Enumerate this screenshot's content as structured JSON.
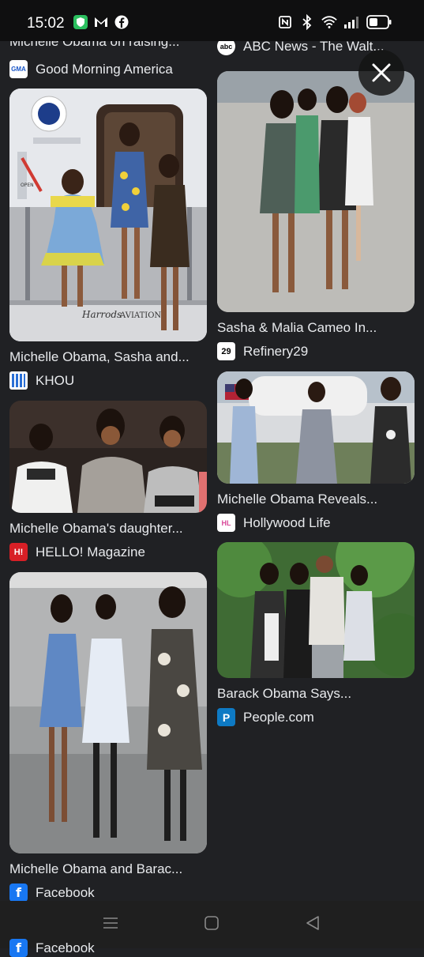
{
  "status_bar": {
    "time": "15:02",
    "left_icons": [
      "shield-icon",
      "gmail-icon",
      "facebook-icon"
    ],
    "right_icons": [
      "nfc-icon",
      "bluetooth-icon",
      "wifi-icon",
      "signal-icon",
      "battery-icon"
    ]
  },
  "close_label": "close",
  "top_fragment": {
    "left": {
      "caption": "Michelle Obama on raising...",
      "source": "Good Morning America",
      "source_badge": "GMA"
    },
    "right": {
      "source": "ABC News - The Walt...",
      "source_badge": "abc"
    }
  },
  "results": {
    "left": [
      {
        "caption": "Michelle Obama, Sasha and...",
        "source": "KHOU",
        "badge_text": ""
      },
      {
        "caption": "Michelle Obama's daughter...",
        "source": "HELLO! Magazine",
        "badge_text": "H!"
      },
      {
        "caption": "Michelle Obama and Barac...",
        "source": "Facebook",
        "badge_text": "f"
      }
    ],
    "right": [
      {
        "caption": "Sasha & Malia Cameo In...",
        "source": "Refinery29",
        "badge_text": "29"
      },
      {
        "caption": "Michelle Obama Reveals...",
        "source": "Hollywood Life",
        "badge_text": "HL"
      },
      {
        "caption": "Barack Obama Says...",
        "source": "People.com",
        "badge_text": "P"
      }
    ]
  },
  "image_texts": {
    "aviation": "AVIATION",
    "harrods": "Harrods",
    "open": "OPEN"
  },
  "bottom_fragment": {
    "source": "Facebook",
    "badge_text": "f"
  },
  "colors": {
    "background": "#202124",
    "statusbar": "#0f0f10",
    "text": "#e8eaed"
  }
}
